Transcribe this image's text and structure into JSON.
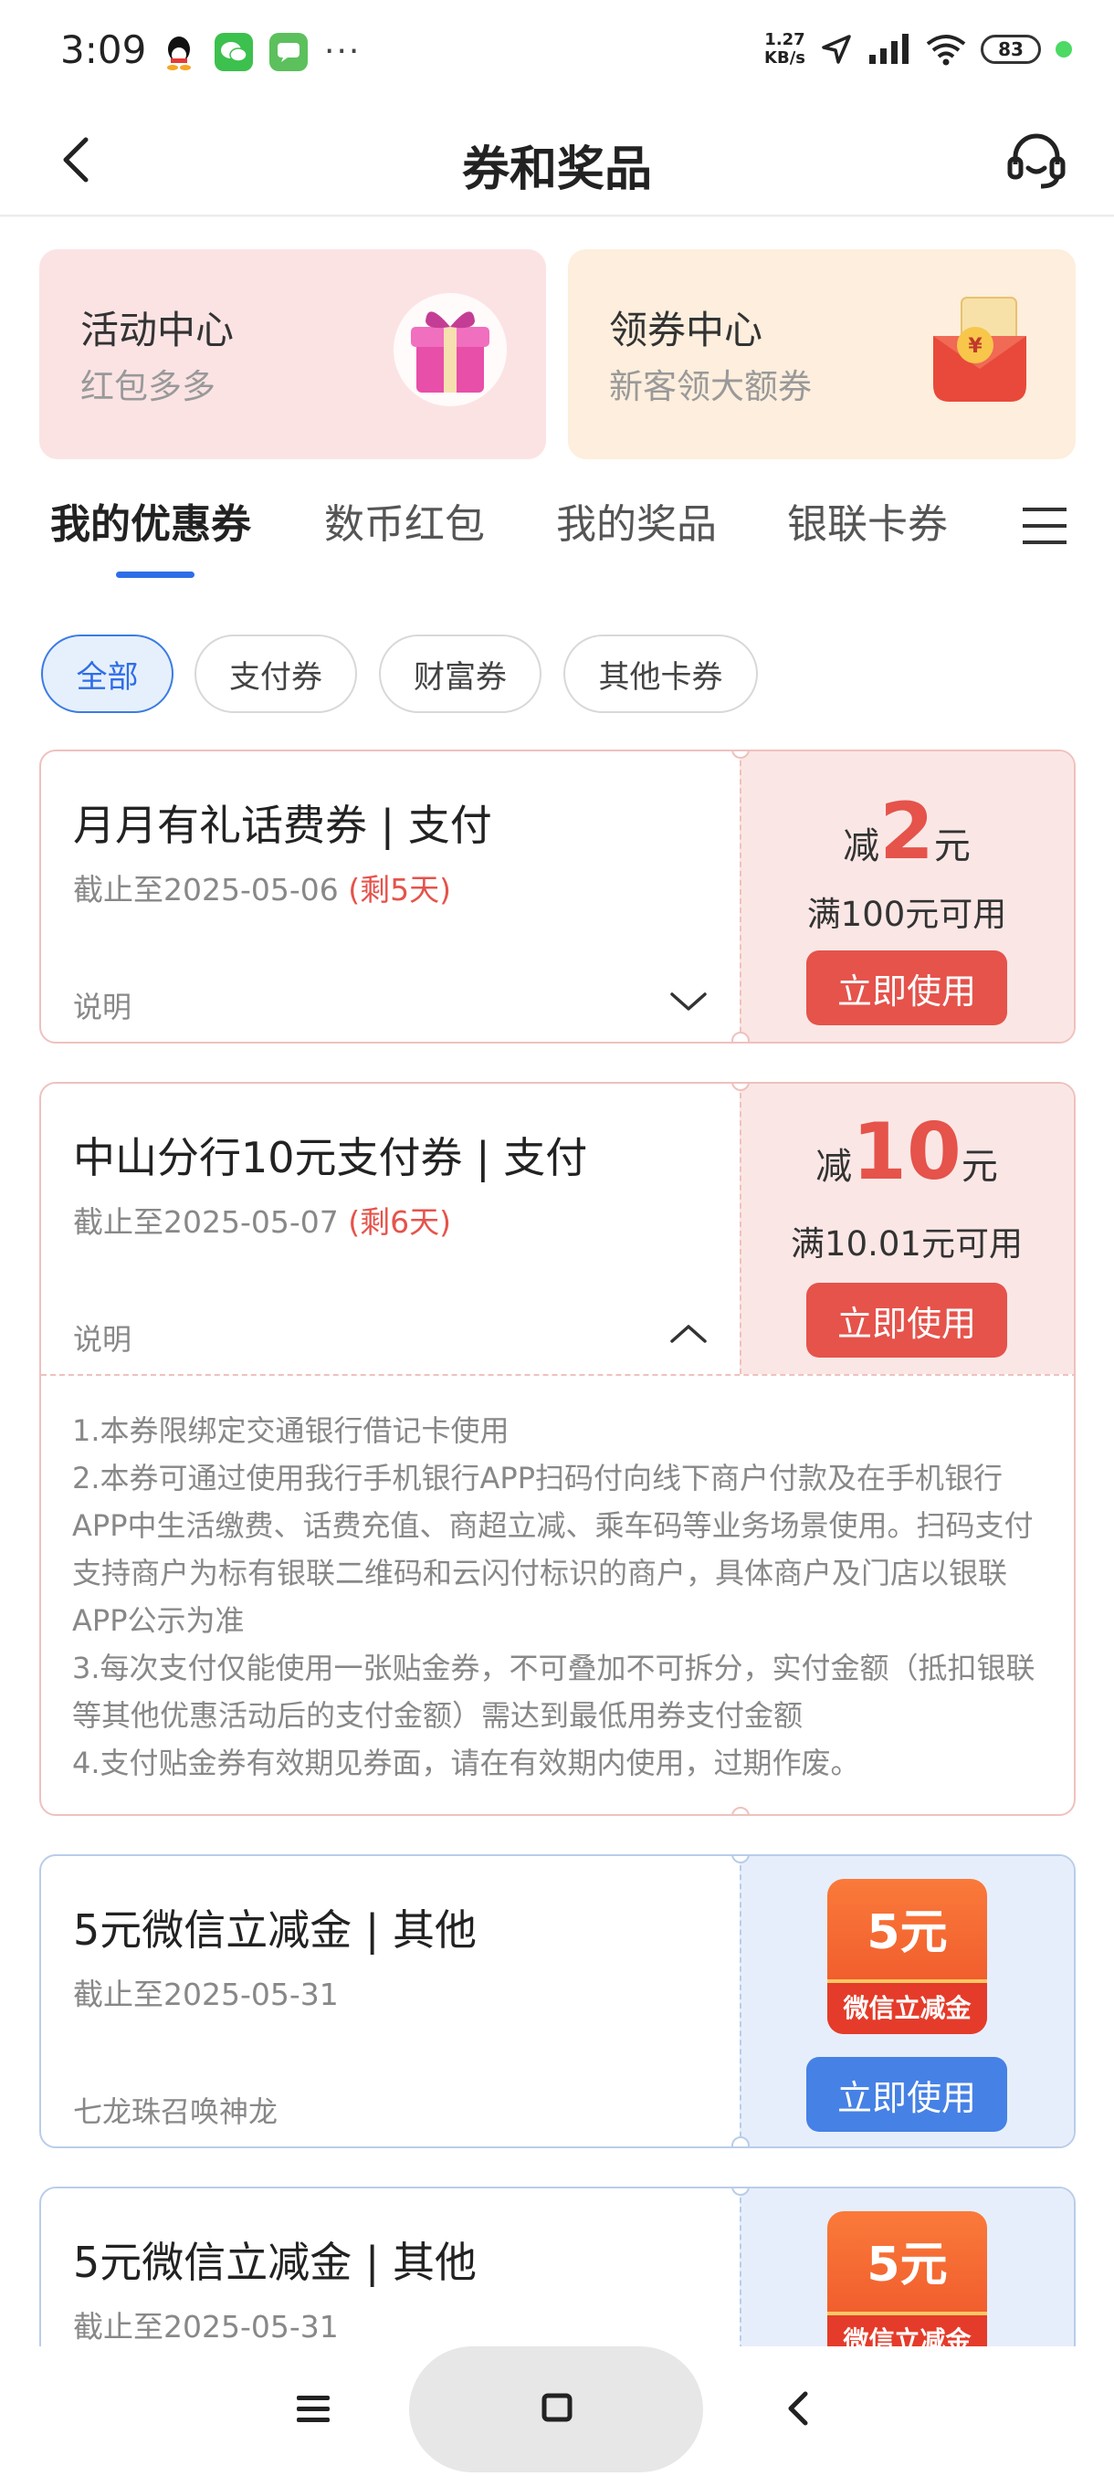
{
  "status_bar": {
    "time": "3:09",
    "speed_top": "1.27",
    "speed_bottom": "KB/s",
    "battery": "83"
  },
  "header": {
    "title": "券和奖品"
  },
  "top_cards": [
    {
      "title": "活动中心",
      "subtitle": "红包多多"
    },
    {
      "title": "领券中心",
      "subtitle": "新客领大额券"
    }
  ],
  "tabs": [
    "我的优惠券",
    "数币红包",
    "我的奖品",
    "银联卡券"
  ],
  "filters": [
    "全部",
    "支付券",
    "财富券",
    "其他卡券"
  ],
  "coupons": [
    {
      "title": "月月有礼话费券 | 支付",
      "date": "截止至2025-05-06",
      "remain": "(剩5天)",
      "note": "说明",
      "prefix": "减",
      "amount": "2",
      "suffix": "元",
      "condition": "满100元可用",
      "button": "立即使用"
    },
    {
      "title": "中山分行10元支付券 | 支付",
      "date": "截止至2025-05-07",
      "remain": "(剩6天)",
      "note": "说明",
      "prefix": "减",
      "amount": "10",
      "suffix": "元",
      "condition": "满10.01元可用",
      "button": "立即使用",
      "description": [
        "1.本券限绑定交通银行借记卡使用",
        "2.本券可通过使用我行手机银行APP扫码付向线下商户付款及在手机银行APP中生活缴费、话费充值、商超立减、乘车码等业务场景使用。扫码支付支持商户为标有银联二维码和云闪付标识的商户，具体商户及门店以银联APP公示为准",
        "3.每次支付仅能使用一张贴金券，不可叠加不可拆分，实付金额（抵扣银联等其他优惠活动后的支付金额）需达到最低用券支付金额",
        "4.支付贴金券有效期见券面，请在有效期内使用，过期作废。"
      ]
    },
    {
      "title": "5元微信立减金 | 其他",
      "date": "截止至2025-05-31",
      "note": "七龙珠召唤神龙",
      "badge_amount": "5元",
      "badge_label": "微信立减金",
      "button": "立即使用"
    },
    {
      "title": "5元微信立减金 | 其他",
      "date": "截止至2025-05-31",
      "badge_amount": "5元",
      "badge_label": "微信立减金"
    }
  ],
  "icons": {
    "back": "back-arrow-icon",
    "service": "customer-service-icon",
    "menu": "menu-icon",
    "gift": "gift-box-icon",
    "red_envelope": "red-envelope-icon"
  },
  "colors": {
    "accent_blue": "#2f6de8",
    "coupon_red": "#e5534b",
    "button_blue": "#4681e5"
  }
}
